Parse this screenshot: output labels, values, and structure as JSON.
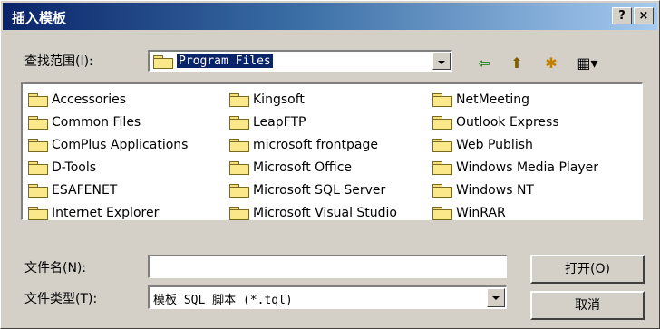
{
  "title": "插入模板",
  "title_buttons": {
    "help": "?",
    "close": "×"
  },
  "lookin": {
    "label": "查找范围(I):",
    "value": "Program Files"
  },
  "toolbar": {
    "back_icon": "⇦",
    "up_icon": "⬆",
    "newfolder_icon": "✱",
    "views_icon": "▦▾"
  },
  "folders": {
    "col1": [
      "Accessories",
      "Common Files",
      "ComPlus Applications",
      "D-Tools",
      "ESAFENET",
      "Internet Explorer"
    ],
    "col2": [
      "Kingsoft",
      "LeapFTP",
      "microsoft frontpage",
      "Microsoft Office",
      "Microsoft SQL Server",
      "Microsoft Visual Studio"
    ],
    "col3": [
      "NetMeeting",
      "Outlook Express",
      "Web Publish",
      "Windows Media Player",
      "Windows NT",
      "WinRAR"
    ]
  },
  "filename": {
    "label": "文件名(N):",
    "value": ""
  },
  "filetype": {
    "label": "文件类型(T):",
    "value": "模板 SQL 脚本 (*.tql)"
  },
  "buttons": {
    "open": "打开(O)",
    "cancel": "取消"
  }
}
